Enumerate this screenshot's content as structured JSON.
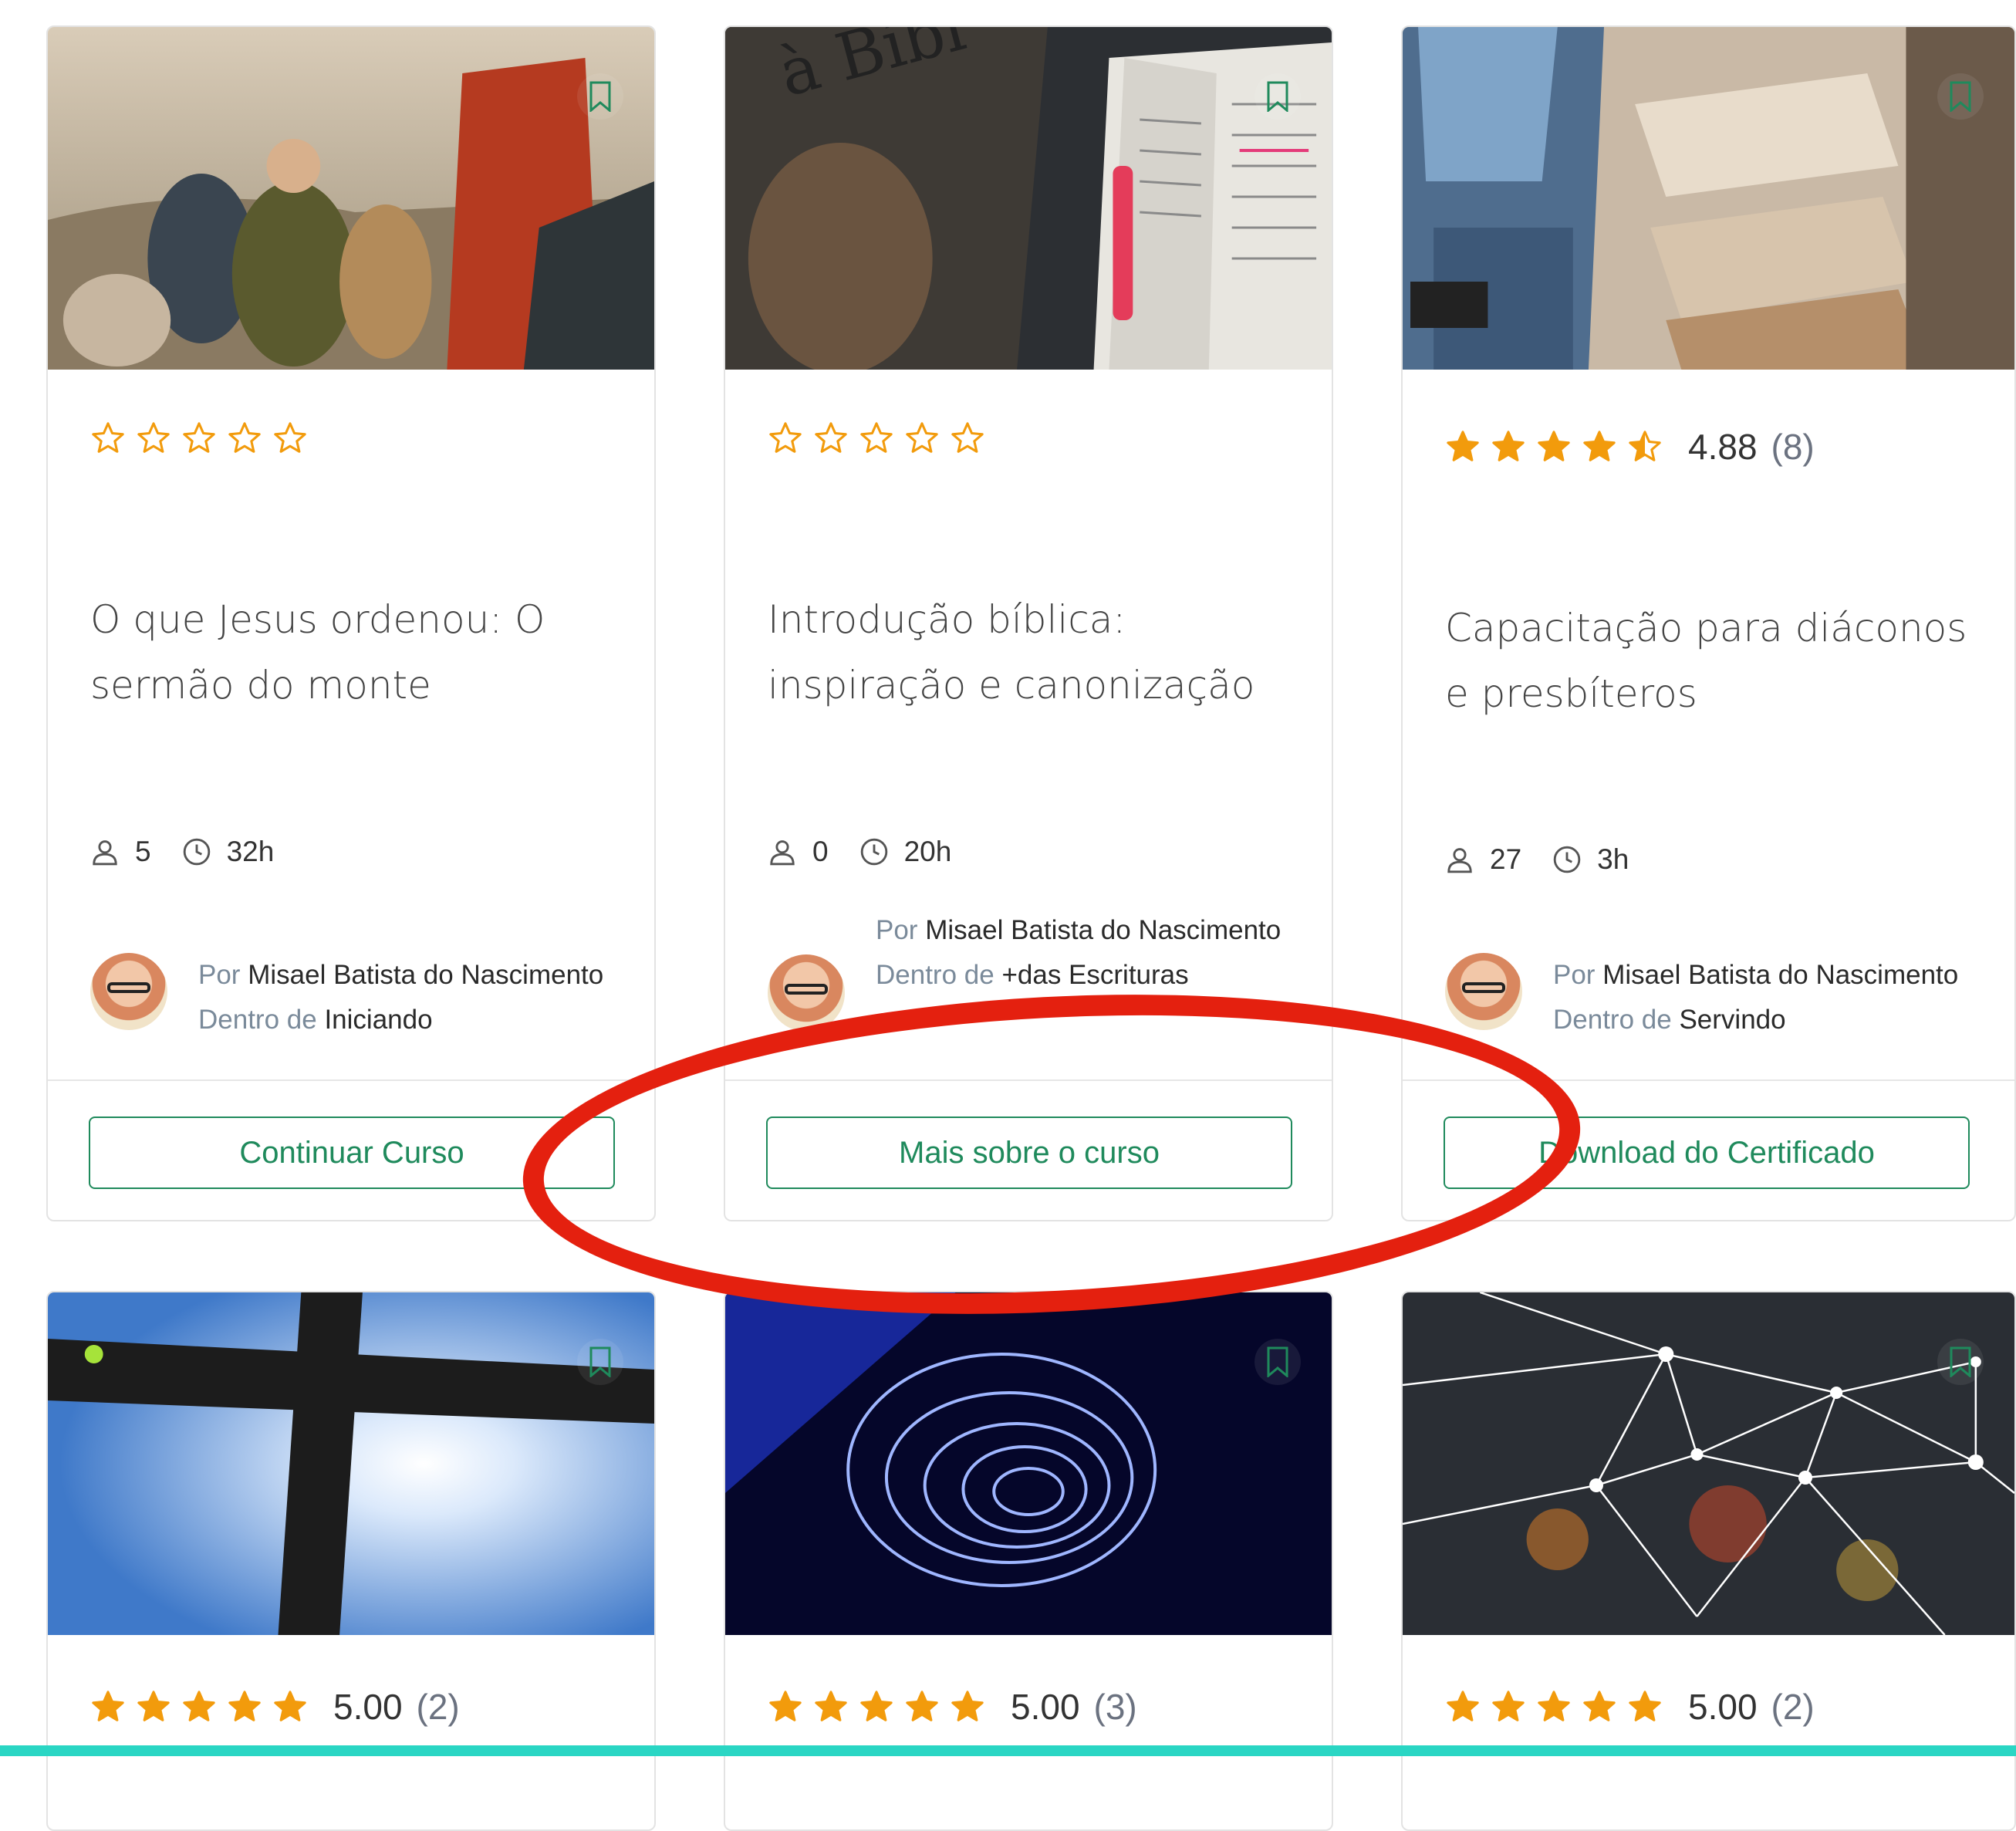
{
  "cards": [
    {
      "title": "O que Jesus ordenou: O sermão do monte",
      "rating": null,
      "students": "5",
      "duration": "32h",
      "author_prefix": "Por",
      "author_name": "Misael Batista do Nascimento",
      "category_prefix": "Dentro de",
      "category": "Iniciando",
      "button_label": "Continuar Curso"
    },
    {
      "title": "Introdução bíblica: inspiração e canonização",
      "rating": null,
      "students": "0",
      "duration": "20h",
      "author_prefix": "Por",
      "author_name": "Misael Batista do Nascimento",
      "category_prefix": "Dentro de",
      "category": "+das Escrituras",
      "button_label": "Mais sobre o curso"
    },
    {
      "title": "Capacitação para diáconos e presbíteros",
      "rating": 4.88,
      "rating_display": "4.88",
      "rating_count": "(8)",
      "students": "27",
      "duration": "3h",
      "author_prefix": "Por",
      "author_name": "Misael Batista do Nascimento",
      "category_prefix": "Dentro de",
      "category": "Servindo",
      "button_label": "Download do Certificado"
    },
    {
      "rating": 5.0,
      "rating_display": "5.00",
      "rating_count": "(2)"
    },
    {
      "rating": 5.0,
      "rating_display": "5.00",
      "rating_count": "(3)"
    },
    {
      "rating": 5.0,
      "rating_display": "5.00",
      "rating_count": "(2)"
    }
  ],
  "colors": {
    "accent_green": "#1f8a5c",
    "star_orange": "#f29b0c",
    "annotation_red": "#e4200f",
    "bottom_bar": "#2ad6c4"
  },
  "icons": [
    "bookmark-icon",
    "star-icon",
    "user-icon",
    "clock-icon"
  ]
}
